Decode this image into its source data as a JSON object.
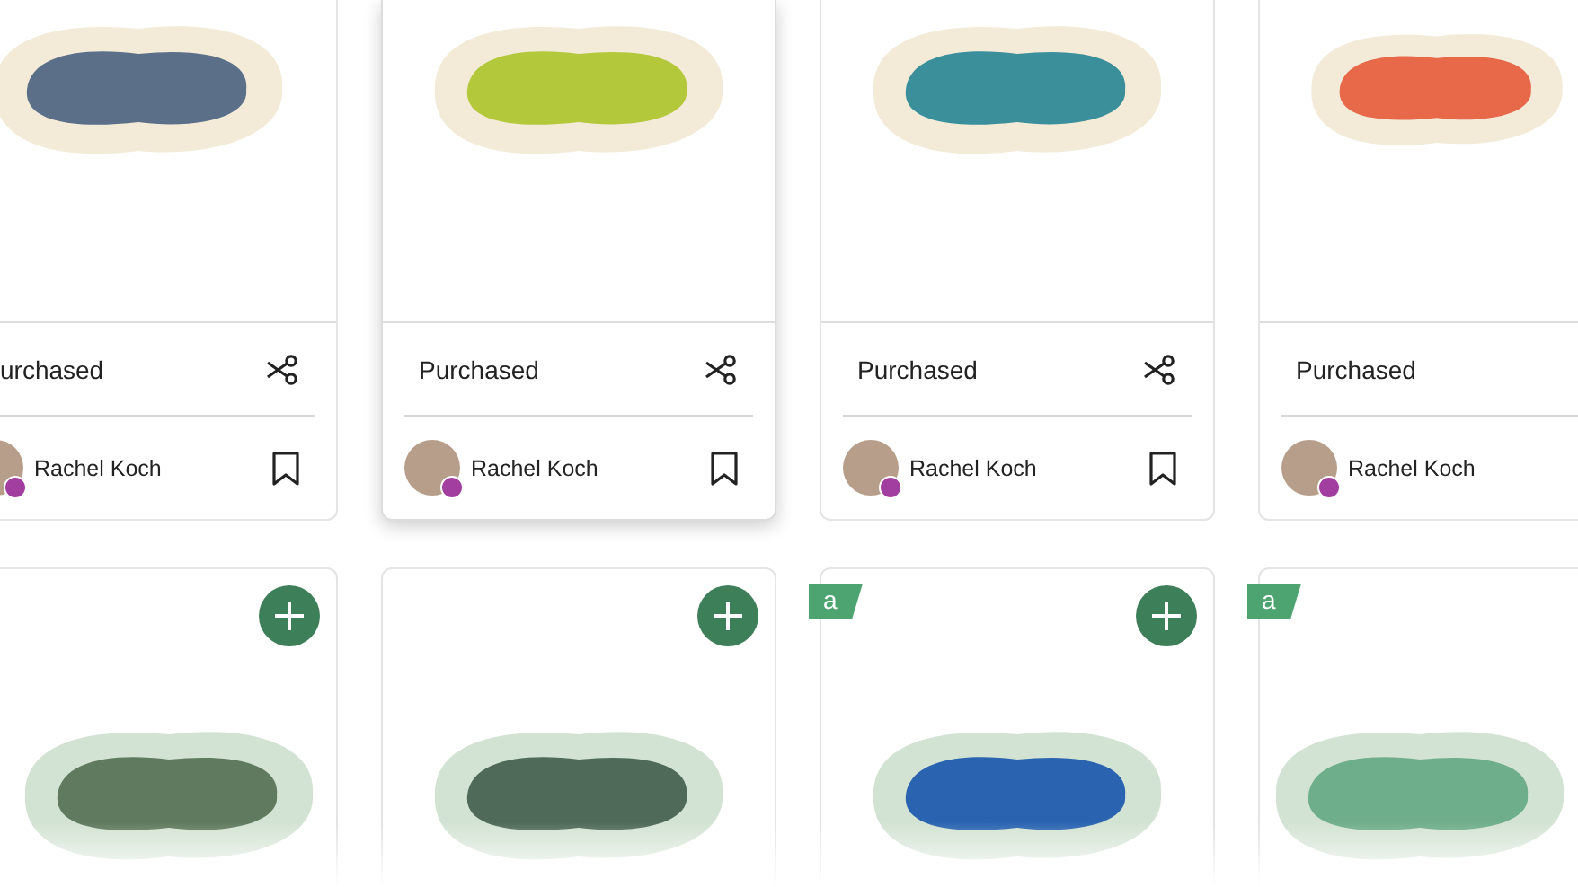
{
  "top_row": [
    {
      "cut_left": true,
      "cut_right": false,
      "highlighted": false,
      "color": "#5b7088",
      "status": "urchased",
      "cut_icon": true,
      "author": "Rachel Koch",
      "bookmark_icon": true
    },
    {
      "cut_left": false,
      "cut_right": false,
      "highlighted": true,
      "color": "#b3c83a",
      "status": "Purchased",
      "cut_icon": true,
      "author": "Rachel Koch",
      "bookmark_icon": true
    },
    {
      "cut_left": false,
      "cut_right": false,
      "highlighted": false,
      "color": "#3a8f9a",
      "status": "Purchased",
      "cut_icon": true,
      "author": "Rachel Koch",
      "bookmark_icon": true
    },
    {
      "cut_left": false,
      "cut_right": true,
      "highlighted": false,
      "color": "#e8684a",
      "status": "Purchased",
      "cut_icon": false,
      "author": "Rachel Koch",
      "bookmark_icon": false
    }
  ],
  "bottom_row": [
    {
      "cut_left": true,
      "cut_right": false,
      "color": "#5f7a5e",
      "add_button": true
    },
    {
      "cut_left": false,
      "cut_right": false,
      "color": "#4f6a58",
      "add_button": true
    },
    {
      "cut_left": false,
      "cut_right": false,
      "color": "#2a64b0",
      "badge": "a",
      "add_button": true
    },
    {
      "cut_left": false,
      "cut_right": true,
      "color": "#6fae8a",
      "badge": "a",
      "add_button": false
    }
  ]
}
